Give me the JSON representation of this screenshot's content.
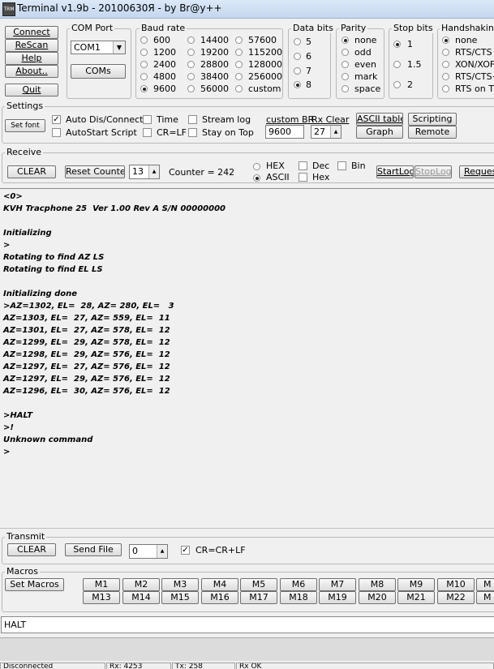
{
  "window": {
    "title": "Terminal v1.9b - 20100630Я - by Br@y++",
    "icon_text": "TRM"
  },
  "connection": {
    "connect": "Connect",
    "rescan": "ReScan",
    "help": "Help",
    "about": "About..",
    "quit": "Quit"
  },
  "com_port": {
    "label": "COM Port",
    "value": "COM1",
    "coms_button": "COMs"
  },
  "baud_rate": {
    "label": "Baud rate",
    "options": [
      "600",
      "1200",
      "2400",
      "4800",
      "9600",
      "14400",
      "19200",
      "28800",
      "38400",
      "56000",
      "57600",
      "115200",
      "128000",
      "256000",
      "custom"
    ],
    "selected": "9600"
  },
  "data_bits": {
    "label": "Data bits",
    "options": [
      "5",
      "6",
      "7",
      "8"
    ],
    "selected": "8"
  },
  "parity": {
    "label": "Parity",
    "options": [
      "none",
      "odd",
      "even",
      "mark",
      "space"
    ],
    "selected": "none"
  },
  "stop_bits": {
    "label": "Stop bits",
    "options": [
      "1",
      "1.5",
      "2"
    ],
    "selected": "1"
  },
  "handshaking": {
    "label": "Handshaking",
    "options": [
      "none",
      "RTS/CTS",
      "XON/XOFF",
      "RTS/CTS+XON/XOFF",
      "RTS on TX"
    ],
    "selected": "none"
  },
  "settings": {
    "label": "Settings",
    "set_font": "Set font",
    "auto_dis_connect": "Auto Dis/Connect",
    "autostart_script": "AutoStart Script",
    "time": "Time",
    "cr_lf": "CR=LF",
    "stream_log": "Stream log",
    "stay_on_top": "Stay on Top",
    "custom_br_label": "custom BR",
    "custom_br_value": "9600",
    "rx_clear_label": "Rx Clear",
    "rx_clear_value": "27",
    "ascii_table": "ASCII table",
    "scripting": "Scripting",
    "graph": "Graph",
    "remote": "Remote"
  },
  "receive": {
    "label": "Receive",
    "clear": "CLEAR",
    "reset_counter": "Reset Counter",
    "counter_spin": "13",
    "counter_label": "Counter = 242",
    "hex": "HEX",
    "ascii": "ASCII",
    "dec": "Dec",
    "hex_chk": "Hex",
    "bin": "Bin",
    "start_log": "StartLog",
    "stop_log": "StopLog",
    "request": "Reques"
  },
  "terminal_lines": [
    "<0>",
    "KVH Tracphone 25  Ver 1.00 Rev A S/N 00000000",
    "",
    "Initializing",
    ">",
    "Rotating to find AZ LS",
    "Rotating to find EL LS",
    "",
    "Initializing done",
    ">AZ=1302, EL=  28, AZ= 280, EL=   3",
    "AZ=1303, EL=  27, AZ= 559, EL=  11",
    "AZ=1301, EL=  27, AZ= 578, EL=  12",
    "AZ=1299, EL=  29, AZ= 578, EL=  12",
    "AZ=1298, EL=  29, AZ= 576, EL=  12",
    "AZ=1297, EL=  27, AZ= 576, EL=  12",
    "AZ=1297, EL=  29, AZ= 576, EL=  12",
    "AZ=1296, EL=  30, AZ= 576, EL=  12",
    "",
    ">HALT",
    ">!",
    "Unknown command",
    ">"
  ],
  "transmit": {
    "label": "Transmit",
    "clear": "CLEAR",
    "send_file": "Send File",
    "spin_value": "0",
    "cr_crlf": "CR=CR+LF"
  },
  "macros": {
    "label": "Macros",
    "set_macros": "Set Macros",
    "row1": [
      "M1",
      "M2",
      "M3",
      "M4",
      "M5",
      "M6",
      "M7",
      "M8",
      "M9",
      "M10",
      "M"
    ],
    "row2": [
      "M13",
      "M14",
      "M15",
      "M16",
      "M17",
      "M18",
      "M19",
      "M20",
      "M21",
      "M22",
      "M"
    ]
  },
  "transmit_input": {
    "value": "HALT"
  },
  "status_bar": {
    "cells": [
      "Disconnected",
      "Rx: 4253",
      "Tx: 258",
      "Rx OK"
    ]
  }
}
